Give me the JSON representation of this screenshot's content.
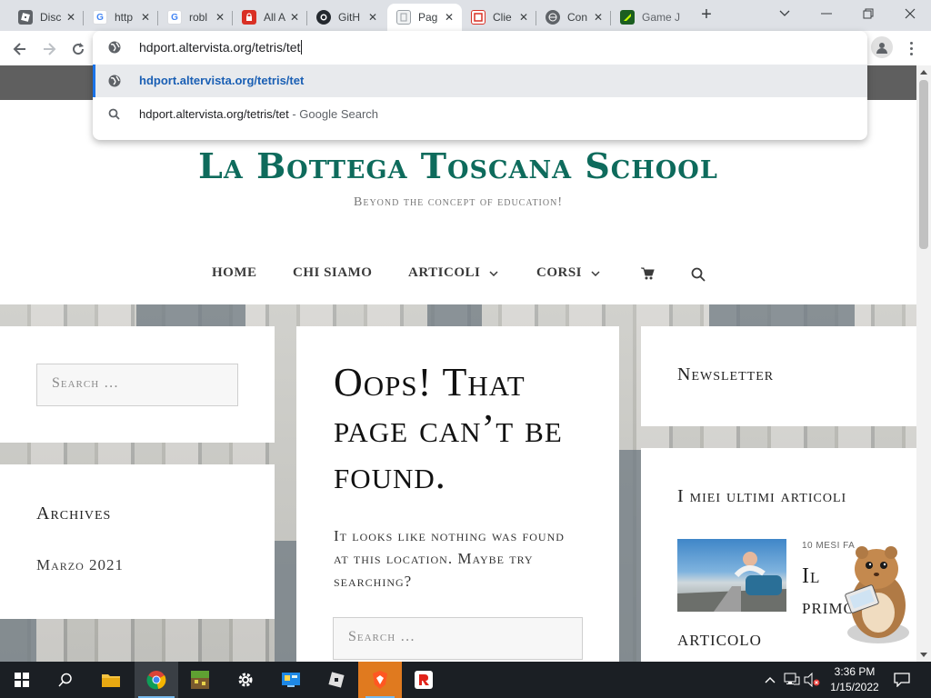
{
  "browser": {
    "tabs": [
      {
        "label": "Disc",
        "icon": "roblox-icon",
        "color": "#5f6368"
      },
      {
        "label": "http",
        "icon": "google-icon",
        "color": "#4285f4"
      },
      {
        "label": "robl",
        "icon": "google-icon",
        "color": "#4285f4"
      },
      {
        "label": "All A",
        "icon": "lock-app-icon",
        "color": "#d93025"
      },
      {
        "label": "GitH",
        "icon": "github-icon",
        "color": "#24292f"
      },
      {
        "label": "Pag",
        "icon": "page-icon",
        "color": "#9aa0a6",
        "active": true
      },
      {
        "label": "Clie",
        "icon": "client-icon",
        "color": "#d93025"
      },
      {
        "label": "Con",
        "icon": "globe-icon",
        "color": "#5f6368"
      },
      {
        "label": "Game Jo",
        "icon": "game-icon",
        "color": "#2e7d32"
      }
    ],
    "new_tab": "+",
    "close_glyph": "✕",
    "omnibox": {
      "value": "hdport.altervista.org/tetris/tet",
      "suggestions": [
        {
          "text": "hdport.altervista.org/tetris/tet",
          "suffix": "",
          "icon": "globe-icon"
        },
        {
          "text": "hdport.altervista.org/tetris/tet",
          "suffix": " - Google Search",
          "icon": "search-icon"
        }
      ]
    }
  },
  "site": {
    "title": "La Bottega Toscana School",
    "tagline": "Beyond the concept of education!",
    "menu": [
      {
        "label": "HOME",
        "dropdown": false
      },
      {
        "label": "CHI SIAMO",
        "dropdown": false
      },
      {
        "label": "ARTICOLI",
        "dropdown": true
      },
      {
        "label": "CORSI",
        "dropdown": true
      }
    ],
    "left": {
      "search_placeholder": "Search …",
      "archives_heading": "Archives",
      "archives_item": "Marzo 2021"
    },
    "center": {
      "heading": "Oops! That page can’t be found.",
      "body": "It looks like nothing was found at this location. Maybe try searching?",
      "search_placeholder": "Search …"
    },
    "right": {
      "newsletter_heading": "Newsletter",
      "articles_heading": "I miei ultimi articoli",
      "post": {
        "date": "10 MESI FA",
        "title_line1": "Il",
        "title_line2": "primo",
        "title_line3": "articolo"
      }
    },
    "accent_color": "#0e6b5c"
  },
  "taskbar": {
    "time": "3:36 PM",
    "date": "1/15/2022"
  }
}
